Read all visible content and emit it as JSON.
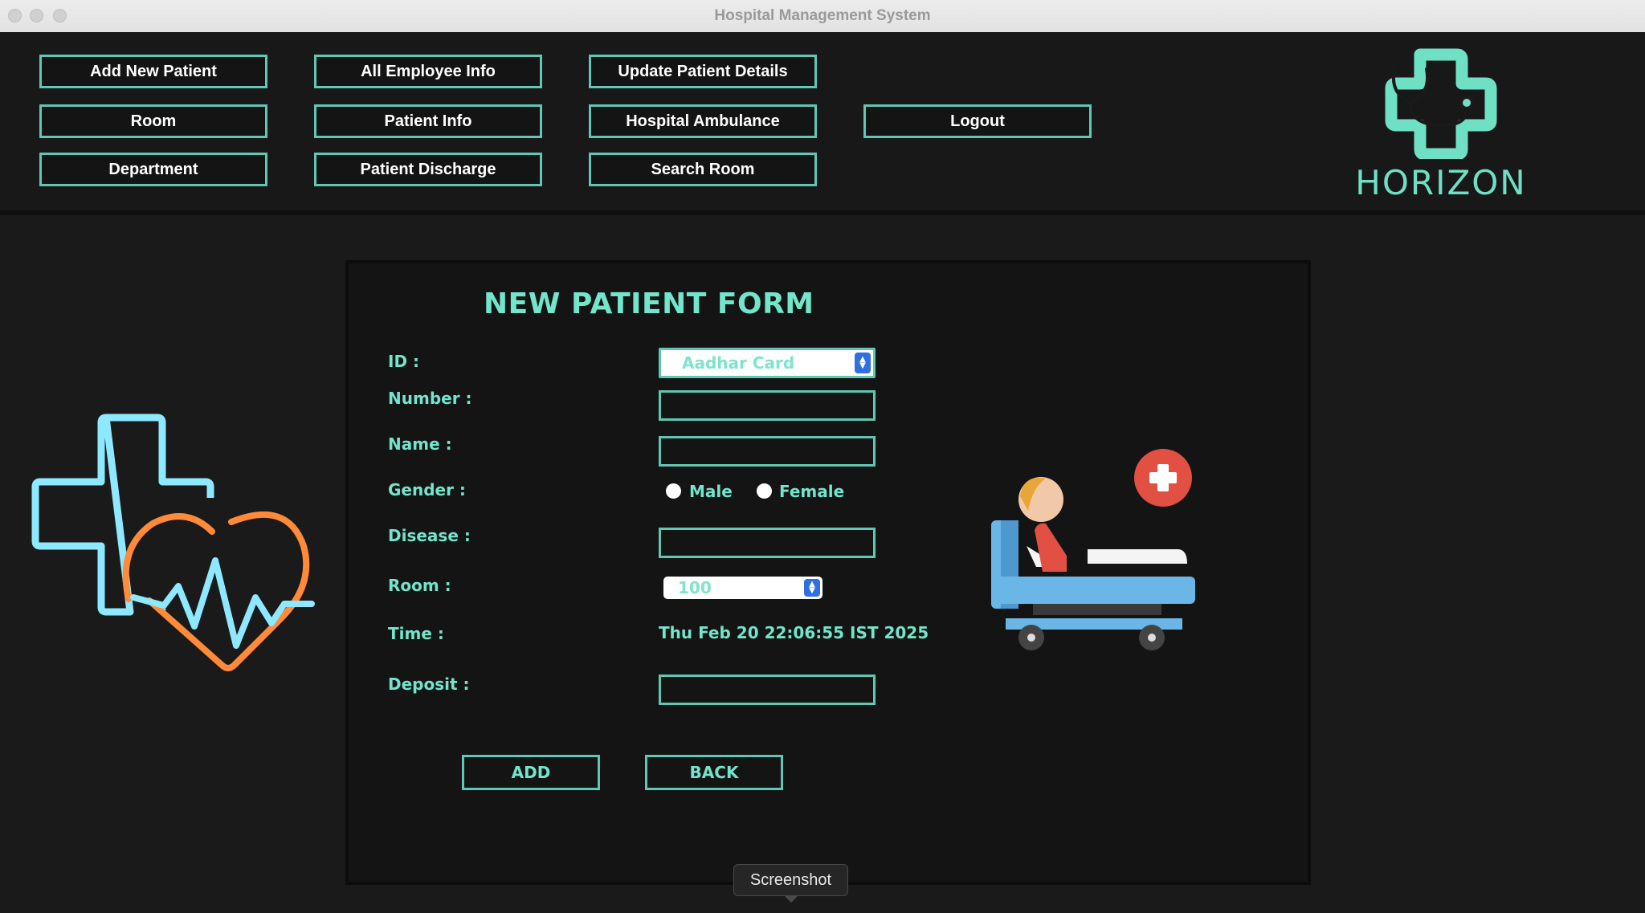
{
  "window": {
    "title": "Hospital Management System"
  },
  "nav": {
    "buttons": [
      "Add New Patient",
      "All Employee Info",
      "Update Patient Details",
      "Room",
      "Patient Info",
      "Hospital Ambulance",
      "Logout",
      "Department",
      "Patient Discharge",
      "Search Room"
    ]
  },
  "logo": {
    "text": "HORIZON",
    "color": "#6fe0c4"
  },
  "form": {
    "title": "NEW PATIENT FORM",
    "labels": {
      "id": "ID :",
      "number": "Number :",
      "name": "Name :",
      "gender": "Gender :",
      "disease": "Disease :",
      "room": "Room :",
      "time": "Time :",
      "deposit": "Deposit :"
    },
    "id_select": {
      "value": "Aadhar Card"
    },
    "number_value": "",
    "name_value": "",
    "disease_value": "",
    "deposit_value": "",
    "gender_options": [
      "Male",
      "Female"
    ],
    "room_select": {
      "value": "100"
    },
    "time_value": "Thu Feb 20 22:06:55 IST 2025",
    "add_label": "ADD",
    "back_label": "BACK"
  },
  "tooltip": {
    "text": "Screenshot"
  },
  "colors": {
    "accent": "#5fc7b2",
    "label": "#72e5cb",
    "background": "#1a1a1a",
    "select_arrow": "#2f6fe0"
  }
}
